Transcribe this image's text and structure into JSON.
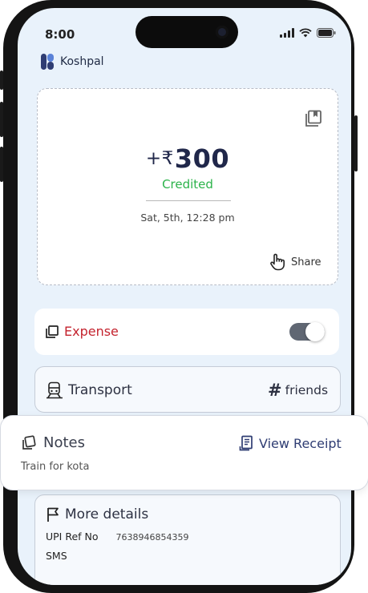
{
  "status_bar": {
    "time": "8:00"
  },
  "app": {
    "name": "Koshpal"
  },
  "transaction": {
    "prefix": "+₹",
    "amount": "300",
    "status": "Credited",
    "datetime": "Sat, 5th, 12:28 pm",
    "share_label": "Share"
  },
  "type_toggle": {
    "label": "Expense",
    "enabled": true
  },
  "category": {
    "label": "Transport",
    "tag": "friends"
  },
  "notes": {
    "title": "Notes",
    "text": "Train for kota",
    "receipt_label": "View Receipt"
  },
  "more_details": {
    "title": "More details",
    "upi_label": "UPI Ref No",
    "upi_value": "7638946854359",
    "sms_label": "SMS"
  },
  "colors": {
    "credited": "#2bb34a",
    "expense": "#c4232e",
    "brand": "#2f3d73",
    "screen_bg": "#e9f2fb"
  },
  "icons": [
    "signal-icon",
    "wifi-icon",
    "battery-icon",
    "koshpal-logo",
    "bookmark-icon",
    "share-hand-icon",
    "copy-icon",
    "train-icon",
    "hash-icon",
    "notes-icon",
    "receipt-icon",
    "flag-icon"
  ]
}
